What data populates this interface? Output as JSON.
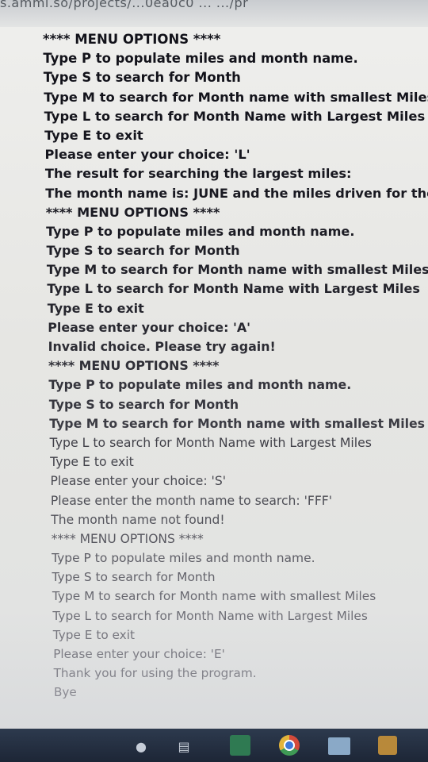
{
  "browser": {
    "url_fragment": "s.ammi.so/projects/...0ea0c0 ... .../pr"
  },
  "console": {
    "lines": [
      "**** MENU OPTIONS ****",
      "Type P to populate miles and month name.",
      "Type S to search for Month",
      "Type M to search for Month name with smallest Miles",
      "Type L to search for Month Name with Largest Miles",
      "Type E to exit",
      "Please enter your choice: 'L'",
      "The result for searching the largest miles:",
      "The month name is: JUNE and the miles driven for the",
      "**** MENU OPTIONS ****",
      "Type P to populate miles and month name.",
      "Type S to search for Month",
      "Type M to search for Month name with smallest Miles",
      "Type L to search for Month Name with Largest Miles",
      "Type E to exit",
      "Please enter your choice: 'A'",
      "Invalid choice. Please try again!",
      "**** MENU OPTIONS ****",
      "Type P to populate miles and month name.",
      "Type S to search for Month",
      "Type M to search for Month name with smallest Miles",
      "Type L to search for Month Name with Largest Miles",
      "Type E to exit",
      "Please enter your choice: 'S'",
      "Please enter the month name to search: 'FFF'",
      "The month name not found!",
      "**** MENU OPTIONS ****",
      "Type P to populate miles and month name.",
      "Type S to search for Month",
      "Type M to search for Month name with smallest Miles",
      "Type L to search for Month Name with Largest Miles",
      "Type E to exit",
      "Please enter your choice: 'E'",
      "Thank you for using the program.",
      "Bye"
    ]
  },
  "taskbar": {
    "icons": [
      "microphone-icon",
      "task-view-icon",
      "store-icon",
      "chrome-icon",
      "file-explorer-icon",
      "shopping-bag-icon"
    ]
  }
}
